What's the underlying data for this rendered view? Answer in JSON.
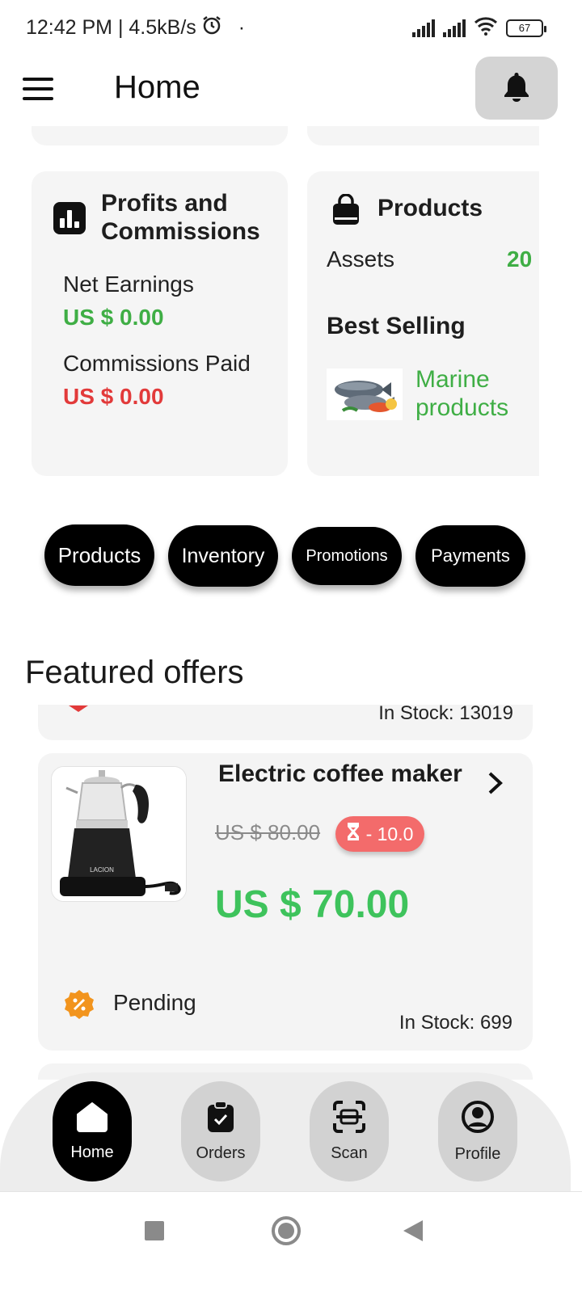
{
  "status_bar": {
    "time_speed": "12:42 PM | 4.5kB/s",
    "dot": "·",
    "battery": "67"
  },
  "header": {
    "title": "Home"
  },
  "profits_card": {
    "title_line1": "Profits and",
    "title_line2": "Commissions",
    "net_label": "Net Earnings",
    "net_value": "US $ 0.00",
    "commissions_label": "Commissions Paid",
    "commissions_value": "US $ 0.00"
  },
  "products_card": {
    "title": "Products",
    "assets_label": "Assets",
    "assets_value": "20",
    "best_selling_label": "Best Selling",
    "best_item_line1": "Marine",
    "best_item_line2": "products"
  },
  "quick_actions": [
    "Products",
    "Inventory",
    "Promotions",
    "Payments"
  ],
  "featured": {
    "title": "Featured offers",
    "prev_stock": "In Stock: 13019",
    "offer": {
      "name": "Electric coffee maker",
      "old_price": "US $ 80.00",
      "discount": "- 10.0",
      "price": "US $ 70.00",
      "status": "Pending",
      "stock": "In Stock: 699",
      "brand": "LACION"
    }
  },
  "bottom_nav": [
    {
      "label": "Home",
      "icon": "home-icon",
      "active": true
    },
    {
      "label": "Orders",
      "icon": "clipboard-check-icon",
      "active": false
    },
    {
      "label": "Scan",
      "icon": "scan-icon",
      "active": false
    },
    {
      "label": "Profile",
      "icon": "profile-icon",
      "active": false
    }
  ],
  "colors": {
    "green": "#3fae45",
    "red": "#e23a3a",
    "discount": "#f36b6b",
    "status": "#f2941d"
  }
}
